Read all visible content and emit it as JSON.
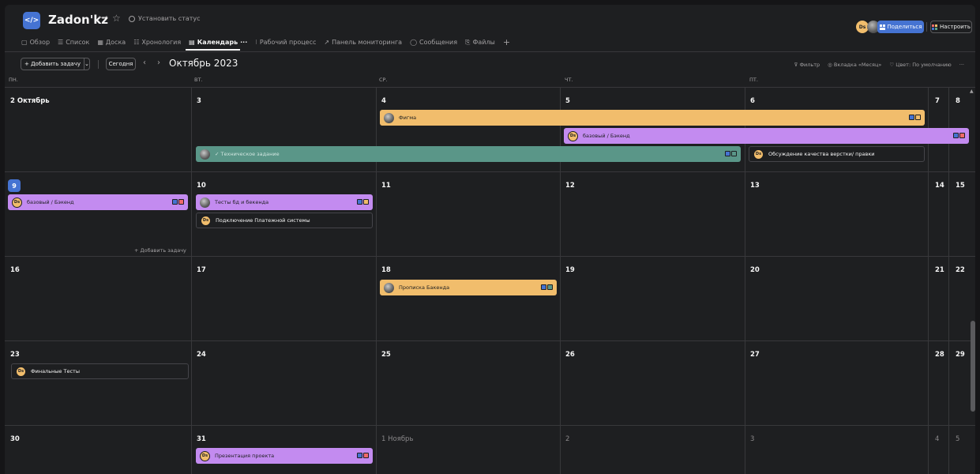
{
  "header": {
    "project_icon": "</>",
    "project_name": "Zadon'kz",
    "chevron": "﹀",
    "star": "☆",
    "set_status": "Установить статус",
    "avatar_initials": "Ds",
    "share_label": "Поделиться",
    "configure_label": "Настроить",
    "tabs": [
      {
        "icon": "▢",
        "label": "Обзор"
      },
      {
        "icon": "☰",
        "label": "Список"
      },
      {
        "icon": "▦",
        "label": "Доска"
      },
      {
        "icon": "☷",
        "label": "Хронология"
      },
      {
        "icon": "▤",
        "label": "Календарь"
      },
      {
        "icon": "⁝",
        "label": "Рабочий процесс"
      },
      {
        "icon": "↗",
        "label": "Панель мониторинга"
      },
      {
        "icon": "◯",
        "label": "Сообщения"
      },
      {
        "icon": "⎘",
        "label": "Файлы"
      }
    ],
    "tab_more": "···",
    "tab_add": "+"
  },
  "toolbar": {
    "add_task": "+ Добавить задачу",
    "add_task_dropdown": "⌄",
    "today": "Сегодня",
    "prev": "‹",
    "next": "›",
    "month": "Октябрь 2023",
    "filter": "Фильтр",
    "view": "Вкладка «Месяц»",
    "color": "Цвет: По умолчанию",
    "more": "···"
  },
  "weekdays": [
    "ПН.",
    "ВТ.",
    "СР.",
    "ЧТ.",
    "ПТ."
  ],
  "days": {
    "w1": [
      "2 Октябрь",
      "3",
      "4",
      "5",
      "6",
      "7",
      "8"
    ],
    "w2": [
      "9",
      "10",
      "11",
      "12",
      "13",
      "14",
      "15"
    ],
    "w3": [
      "16",
      "17",
      "18",
      "19",
      "20",
      "21",
      "22"
    ],
    "w4": [
      "23",
      "24",
      "25",
      "26",
      "27",
      "28",
      "29"
    ],
    "w5": [
      "30",
      "31",
      "1 Ноябрь",
      "2",
      "3",
      "4",
      "5"
    ]
  },
  "tasks": {
    "figma": "Фигма",
    "backend_w1": "базовый / Бэкенд",
    "tech_spec": "✓ Техническое задание",
    "quality_discuss": "Обсуждение качества верстки/ правки",
    "backend_w2": "базовый / Бэкенд",
    "tests_db": "Тесты бд и бекенда",
    "payment": "Подключение Платежной системы",
    "add_task_cell": "+ Добавить задачу",
    "backend_prop": "Прописка Бакенда",
    "final_tests": "Финальные Тесты",
    "presentation": "Презентация проекта"
  },
  "colors": {
    "accent_blue": "#4573d2",
    "task_orange": "#f1bd6c",
    "task_purple": "#c38bf0",
    "task_teal": "#5a9688",
    "background": "#1e1f21"
  }
}
